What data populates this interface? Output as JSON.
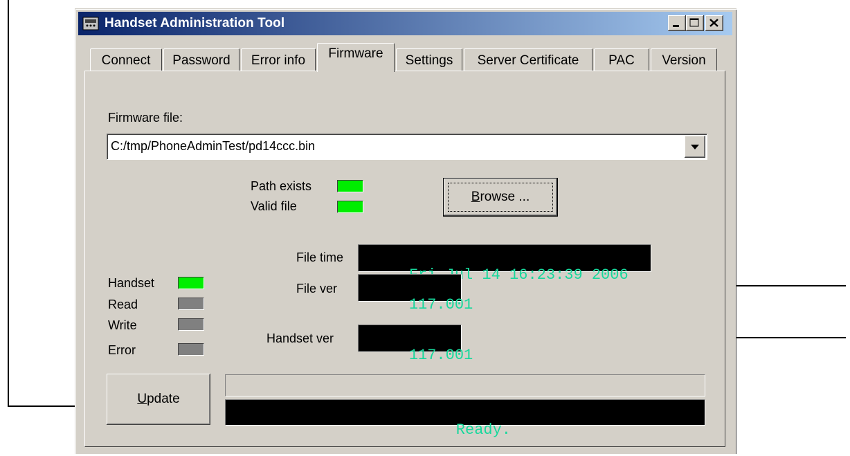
{
  "window": {
    "title": "Handset Administration Tool"
  },
  "tabs": [
    {
      "label": "Connect",
      "active": false
    },
    {
      "label": "Password",
      "active": false
    },
    {
      "label": "Error info",
      "active": false
    },
    {
      "label": "Firmware",
      "active": true
    },
    {
      "label": "Settings",
      "active": false
    },
    {
      "label": "Server Certificate",
      "active": false
    },
    {
      "label": "PAC",
      "active": false
    },
    {
      "label": "Version",
      "active": false
    }
  ],
  "firmware": {
    "file_label": "Firmware file:",
    "file_path": "C:/tmp/PhoneAdminTest/pd14ccc.bin",
    "path_exists_label": "Path exists",
    "path_exists": true,
    "valid_file_label": "Valid file",
    "valid_file": true,
    "browse_label": "Browse ...",
    "file_time_label": "File time",
    "file_time": "Fri Jul 14 16:23:39 2006",
    "file_ver_label": "File ver",
    "file_ver": "117.001",
    "handset_ver_label": "Handset ver",
    "handset_ver": "117.001",
    "status": {
      "handset_label": "Handset",
      "handset": true,
      "read_label": "Read",
      "read": false,
      "write_label": "Write",
      "write": false,
      "error_label": "Error",
      "error": false
    },
    "update_label": "Update",
    "progress": 0,
    "status_text": "Ready."
  },
  "colors": {
    "led_on": "#00ee00",
    "led_off": "#808080",
    "lcd_text": "#17d89c",
    "title_start": "#0a246a",
    "title_end": "#a6caf0"
  },
  "icons": {
    "app": "phone-icon",
    "minimize": "minimize-icon",
    "maximize": "maximize-icon",
    "close": "close-icon",
    "dropdown": "chevron-down-icon",
    "arrows": "arrow-left-icon"
  }
}
